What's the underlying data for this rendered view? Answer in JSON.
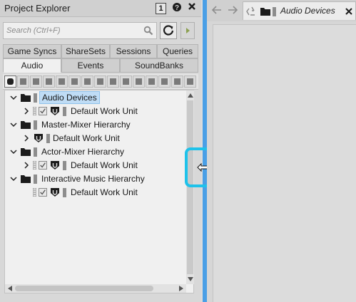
{
  "explorer": {
    "title": "Project Explorer",
    "badge": "1",
    "help_label": "?",
    "search": {
      "placeholder": "Search (Ctrl+F)"
    },
    "tabs_row1": [
      "Game Syncs",
      "ShareSets",
      "Sessions",
      "Queries"
    ],
    "tabs_row2": [
      "Audio",
      "Events",
      "SoundBanks"
    ],
    "active_tab": "Audio",
    "tree": [
      {
        "label": "Audio Devices",
        "type": "folder",
        "expanded": true,
        "selected": true
      },
      {
        "label": "Default Work Unit",
        "type": "work-unit",
        "collapsed": true
      },
      {
        "label": "Master-Mixer Hierarchy",
        "type": "folder",
        "expanded": true
      },
      {
        "label": "Default Work Unit",
        "type": "work-unit",
        "collapsed": true
      },
      {
        "label": "Actor-Mixer Hierarchy",
        "type": "folder",
        "expanded": true
      },
      {
        "label": "Default Work Unit",
        "type": "work-unit",
        "collapsed": true
      },
      {
        "label": "Interactive Music Hierarchy",
        "type": "folder",
        "expanded": true
      },
      {
        "label": "Default Work Unit",
        "type": "work-unit"
      }
    ]
  },
  "document": {
    "tab_title": "Audio Devices"
  },
  "colors": {
    "splitter": "#4a9fe6",
    "highlight": "#1ec2ea",
    "selection": "#bfdcf5"
  }
}
